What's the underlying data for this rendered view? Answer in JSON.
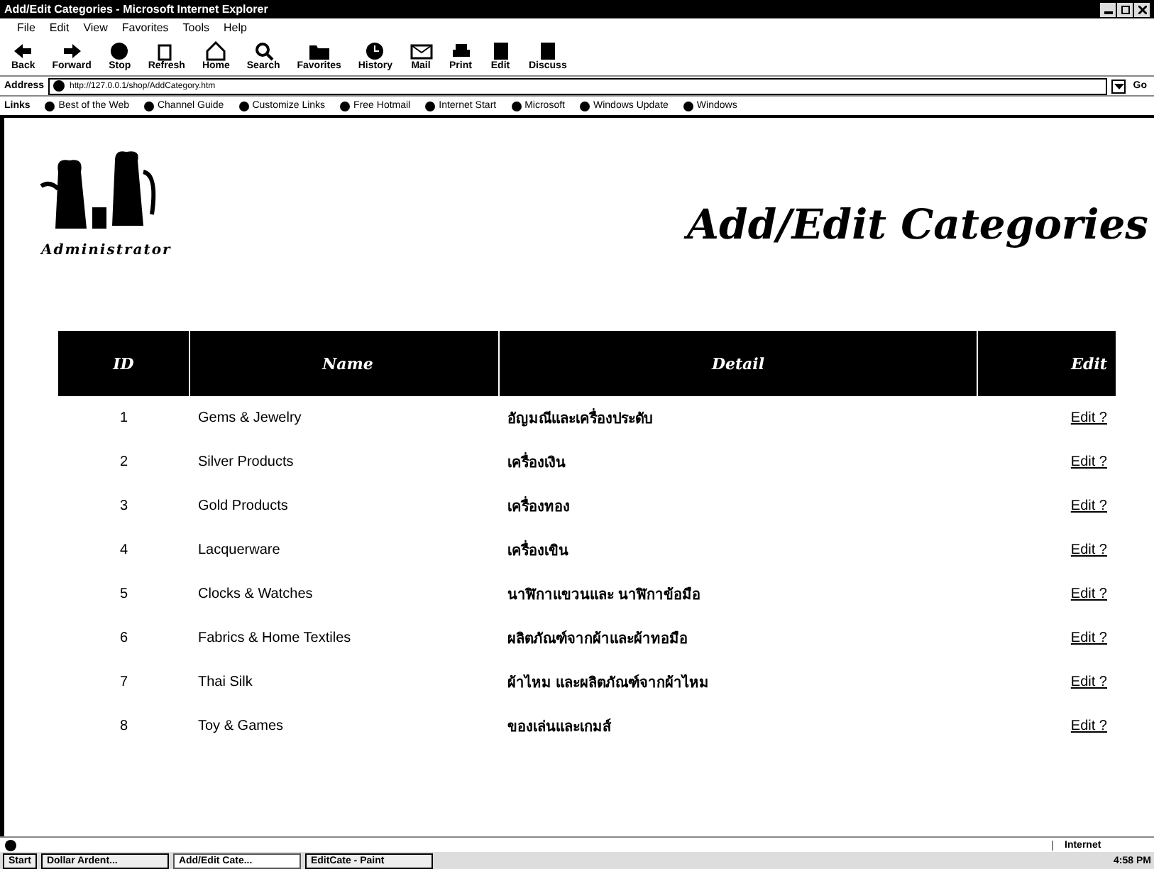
{
  "window": {
    "title": "Add/Edit Categories - Microsoft Internet Explorer"
  },
  "menu": [
    "File",
    "Edit",
    "View",
    "Favorites",
    "Tools",
    "Help"
  ],
  "toolbar": [
    "Back",
    "Forward",
    "Stop",
    "Refresh",
    "Home",
    "Search",
    "Favorites",
    "History",
    "Mail",
    "Print",
    "Edit",
    "Discuss"
  ],
  "address": {
    "label": "Address",
    "value": "http://127.0.0.1/shop/AddCategory.htm",
    "go": "Go"
  },
  "links": {
    "label": "Links",
    "items": [
      "Best of the Web",
      "Channel Guide",
      "Customize Links",
      "Free Hotmail",
      "Internet Start",
      "Microsoft",
      "Windows Update",
      "Windows"
    ]
  },
  "page": {
    "logo_caption": "Administrator",
    "heading": "Add/Edit Categories",
    "table": {
      "columns": [
        "ID",
        "Name",
        "Detail",
        "Edit"
      ],
      "rows": [
        {
          "id": "1",
          "name": "Gems & Jewelry",
          "detail": "อัญมณีและเครื่องประดับ",
          "edit": "Edit ?"
        },
        {
          "id": "2",
          "name": "Silver Products",
          "detail": "เครื่องเงิน",
          "edit": "Edit ?"
        },
        {
          "id": "3",
          "name": "Gold Products",
          "detail": "เครื่องทอง",
          "edit": "Edit ?"
        },
        {
          "id": "4",
          "name": "Lacquerware",
          "detail": "เครื่องเขิน",
          "edit": "Edit ?"
        },
        {
          "id": "5",
          "name": "Clocks & Watches",
          "detail": "นาฬิกาแขวนและ นาฬิกาข้อมือ",
          "edit": "Edit ?"
        },
        {
          "id": "6",
          "name": "Fabrics & Home Textiles",
          "detail": "ผลิตภัณฑ์จากผ้าและผ้าทอมือ",
          "edit": "Edit ?"
        },
        {
          "id": "7",
          "name": "Thai Silk",
          "detail": "ผ้าไหม และผลิตภัณฑ์จากผ้าไหม",
          "edit": "Edit ?"
        },
        {
          "id": "8",
          "name": "Toy & Games",
          "detail": "ของเล่นและเกมส์",
          "edit": "Edit ?"
        }
      ]
    }
  },
  "status_bar": {
    "zone": "Internet"
  },
  "taskbar": {
    "start": "Start",
    "tasks": [
      {
        "label": "Dollar Ardent...",
        "selected": false
      },
      {
        "label": "Add/Edit Cate...",
        "selected": true
      },
      {
        "label": "EditCate - Paint",
        "selected": false
      }
    ],
    "clock": "4:58 PM"
  }
}
